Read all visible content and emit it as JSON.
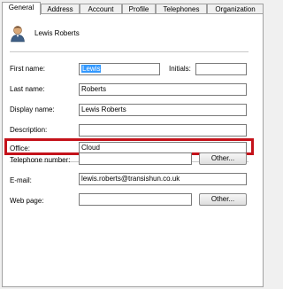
{
  "tabs": [
    {
      "label": "General",
      "active": true
    },
    {
      "label": "Address"
    },
    {
      "label": "Account"
    },
    {
      "label": "Profile"
    },
    {
      "label": "Telephones"
    },
    {
      "label": "Organization"
    }
  ],
  "user": {
    "display": "Lewis Roberts",
    "icon": "user-icon"
  },
  "fields": {
    "first_name": {
      "label": "First name:",
      "value": "Lewis"
    },
    "initials": {
      "label": "Initials:",
      "value": ""
    },
    "last_name": {
      "label": "Last name:",
      "value": "Roberts"
    },
    "display_name": {
      "label": "Display name:",
      "value": "Lewis Roberts"
    },
    "description": {
      "label": "Description:",
      "value": ""
    },
    "office": {
      "label": "Office:",
      "value": "Cloud"
    },
    "telephone": {
      "label": "Telephone number:",
      "value": ""
    },
    "email": {
      "label": "E-mail:",
      "value": "lewis.roberts@transishun.co.uk"
    },
    "web_page": {
      "label": "Web page:",
      "value": ""
    }
  },
  "buttons": {
    "other_label": "Other..."
  },
  "colors": {
    "highlight": "#c4121a",
    "selection": "#3399ff"
  }
}
